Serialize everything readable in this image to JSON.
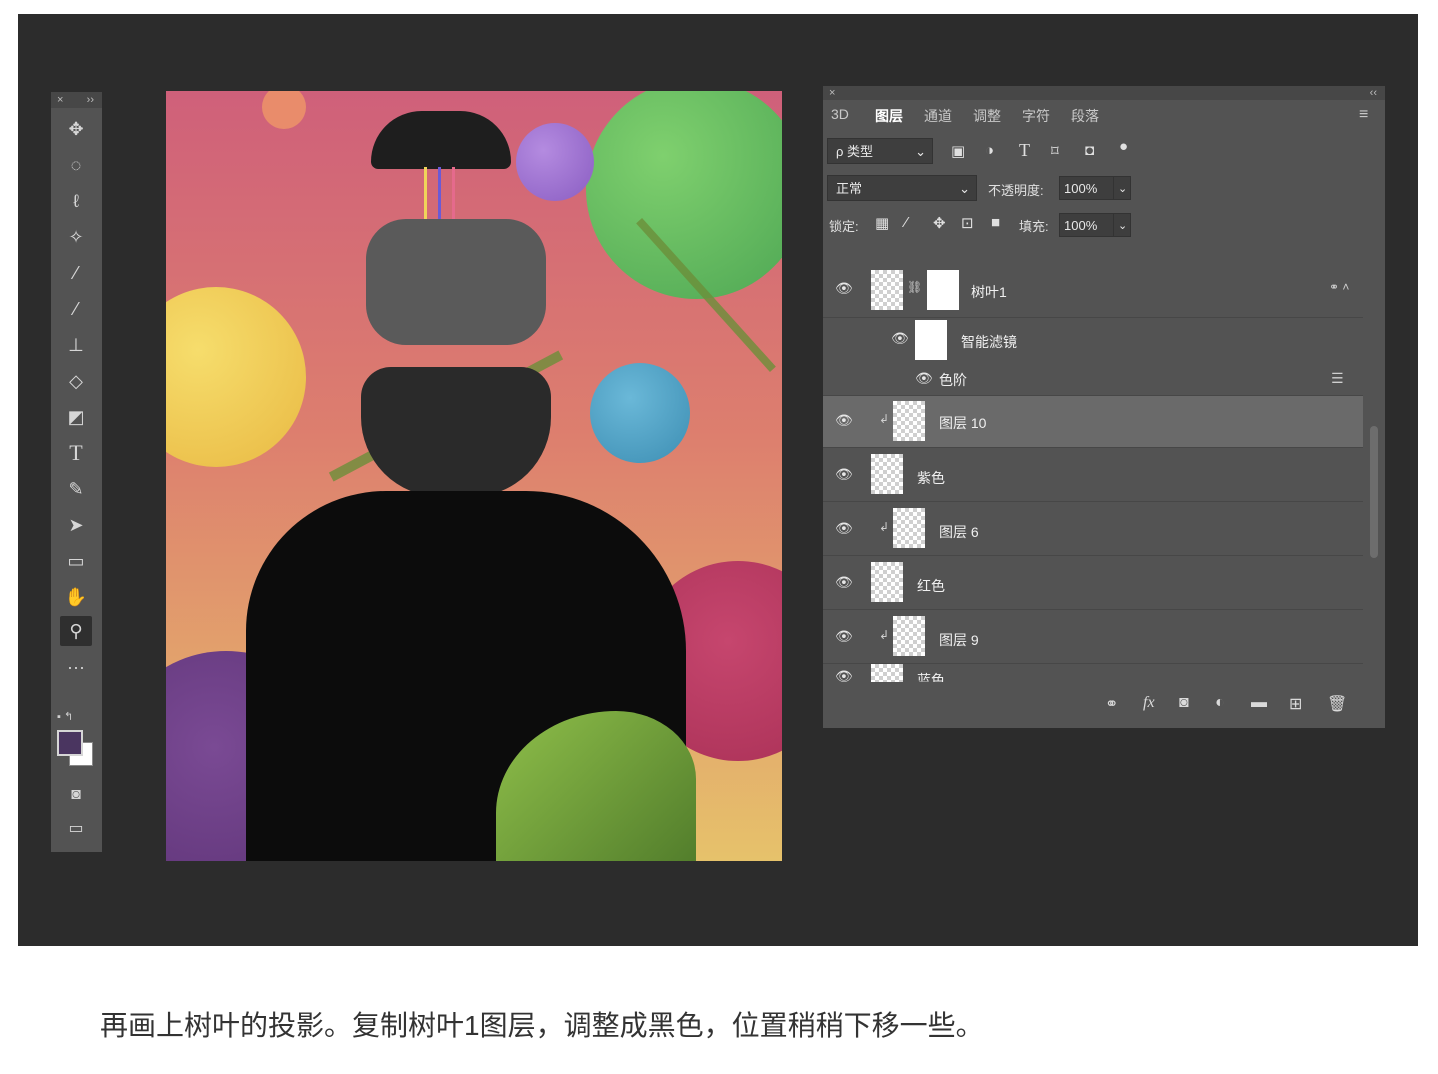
{
  "toolbar": {
    "close": "×",
    "collapse": "››",
    "tools": [
      {
        "icon": "move-icon",
        "glyph": "✥"
      },
      {
        "icon": "marquee-icon",
        "glyph": "◌"
      },
      {
        "icon": "lasso-icon",
        "glyph": "ℓ"
      },
      {
        "icon": "magic-wand-icon",
        "glyph": "✧"
      },
      {
        "icon": "eyedropper-icon",
        "glyph": "⁄"
      },
      {
        "icon": "brush-icon",
        "glyph": "⁄"
      },
      {
        "icon": "stamp-icon",
        "glyph": "⊥"
      },
      {
        "icon": "eraser-icon",
        "glyph": "◇"
      },
      {
        "icon": "bucket-icon",
        "glyph": "◩"
      },
      {
        "icon": "type-icon",
        "glyph": "T"
      },
      {
        "icon": "pen-icon",
        "glyph": "✎"
      },
      {
        "icon": "select-arrow-icon",
        "glyph": "➤"
      },
      {
        "icon": "rectangle-icon",
        "glyph": "▭"
      },
      {
        "icon": "hand-icon",
        "glyph": "✋"
      },
      {
        "icon": "zoom-icon",
        "glyph": "⚲"
      },
      {
        "icon": "more-tools-icon",
        "glyph": "···"
      }
    ],
    "fg_color": "#4a3560",
    "bg_color": "#ffffff"
  },
  "panel": {
    "close": "×",
    "collapse": "‹‹",
    "menu": "≡",
    "tabs": [
      "3D",
      "图层",
      "通道",
      "调整",
      "字符",
      "段落"
    ],
    "active_tab": "图层",
    "filter": "ρ 类型",
    "blend_mode": "正常",
    "opacity_label": "不透明度:",
    "opacity_value": "100%",
    "lock_label": "锁定:",
    "fill_label": "填充:",
    "fill_value": "100%",
    "layers": [
      {
        "name": "树叶1",
        "type": "smart-object"
      },
      {
        "name": "智能滤镜",
        "type": "smart-filter"
      },
      {
        "name": "色阶",
        "type": "filter"
      },
      {
        "name": "图层 10",
        "type": "layer",
        "selected": true
      },
      {
        "name": "紫色",
        "type": "layer"
      },
      {
        "name": "图层 6",
        "type": "layer"
      },
      {
        "name": "红色",
        "type": "layer"
      },
      {
        "name": "图层 9",
        "type": "layer"
      },
      {
        "name": "蓝色",
        "type": "layer"
      }
    ]
  },
  "caption": "再画上树叶的投影。复制树叶1图层，调整成黑色，位置稍稍下移一些。"
}
